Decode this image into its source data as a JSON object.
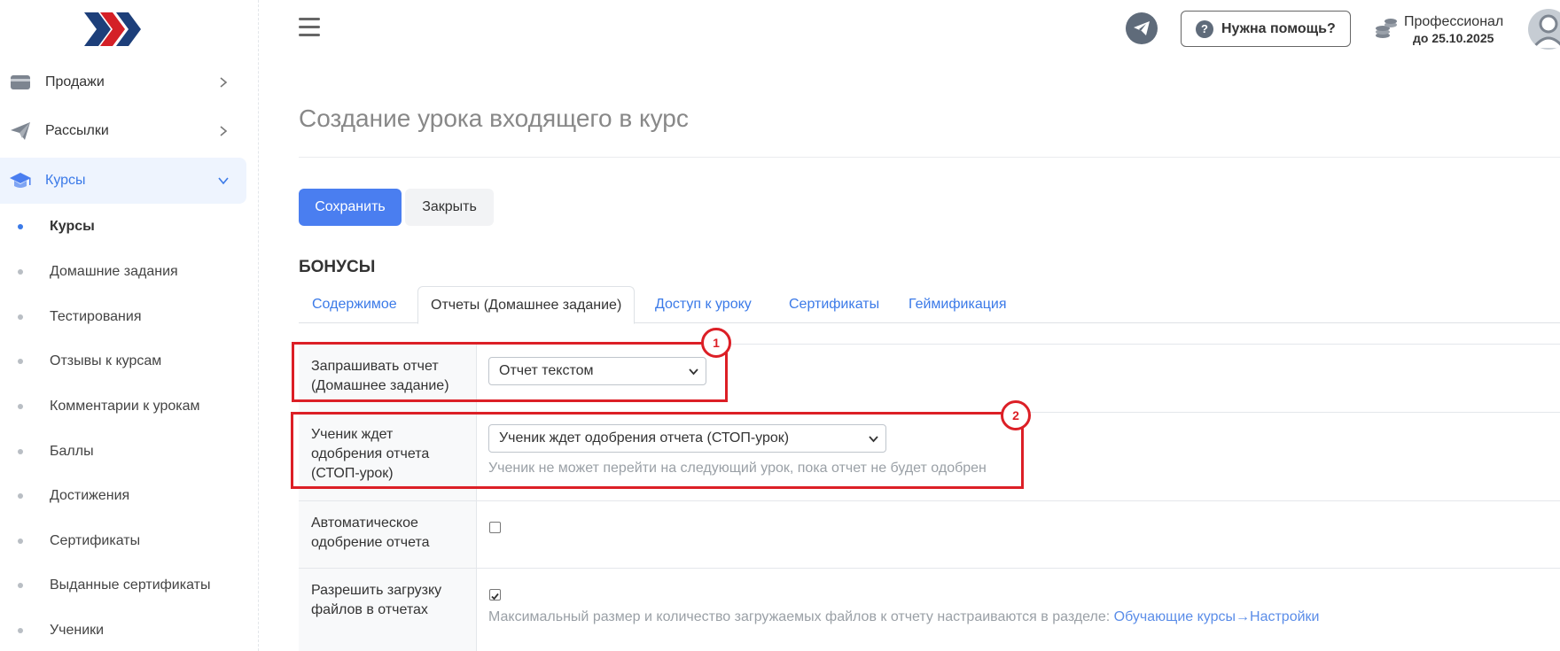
{
  "sidebar": {
    "menu": [
      {
        "label": "Продажи",
        "icon": "card-icon"
      },
      {
        "label": "Рассылки",
        "icon": "paper-plane-icon"
      },
      {
        "label": "Курсы",
        "icon": "graduation-cap-icon"
      }
    ],
    "submenu": [
      "Курсы",
      "Домашние задания",
      "Тестирования",
      "Отзывы к курсам",
      "Комментарии к урокам",
      "Баллы",
      "Достижения",
      "Сертификаты",
      "Выданные сертификаты",
      "Ученики"
    ]
  },
  "header": {
    "help_label": "Нужна помощь?",
    "plan_name": "Профессионал",
    "plan_until": "до 25.10.2025"
  },
  "main": {
    "title": "Создание урока входящего в курс",
    "save_label": "Сохранить",
    "close_label": "Закрыть",
    "section_title": "БОНУСЫ",
    "tabs": [
      "Содержимое",
      "Отчеты (Домашнее задание)",
      "Доступ к уроку",
      "Сертификаты",
      "Геймификация"
    ],
    "active_tab": "Отчеты (Домашнее задание)"
  },
  "form": {
    "report_request_label": "Запрашивать отчет (Домашнее задание)",
    "report_request_value": "Отчет текстом",
    "stop_lesson_label": "Ученик ждет одобрения отчета (СТОП-урок)",
    "stop_lesson_value": "Ученик ждет одобрения отчета (СТОП-урок)",
    "stop_lesson_hint": "Ученик не может перейти на следующий урок, пока отчет не будет одобрен",
    "auto_approve_label": "Автоматическое одобрение отчета",
    "auto_approve_checked": false,
    "file_upload_label": "Разрешить загрузку файлов в отчетах",
    "file_upload_checked": true,
    "file_upload_hint": "Максимальный размер и количество загружаемых файлов к отчету настраиваются в разделе:",
    "file_upload_link": "Обучающие курсы→Настройки"
  },
  "annotations": {
    "badge_1": "1",
    "badge_2": "2"
  },
  "colors": {
    "accent": "#4a7ef0",
    "annotation": "#dc1f26",
    "logo_navy": "#1d3f7a",
    "logo_red": "#d42027"
  }
}
